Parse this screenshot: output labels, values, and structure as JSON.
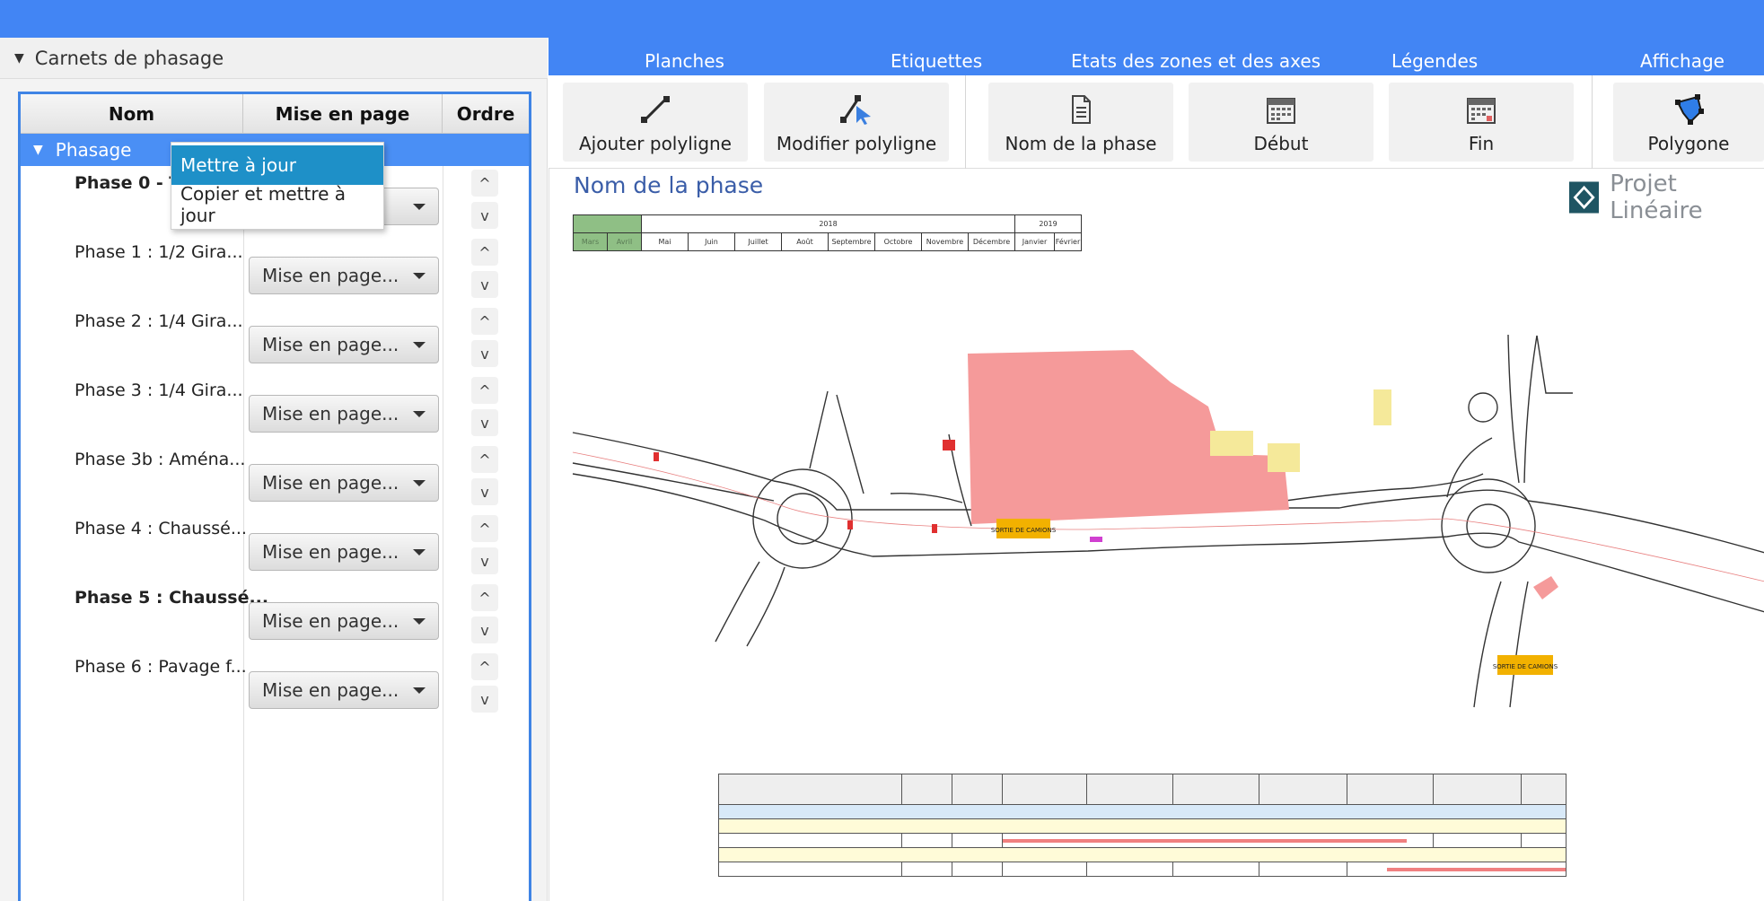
{
  "panel": {
    "title": "Carnets de phasage"
  },
  "table": {
    "headers": {
      "nom": "Nom",
      "mise_en_page": "Mise en page",
      "ordre": "Ordre"
    },
    "group": "Phasage",
    "rows": [
      {
        "name": "Phase 0 - Tr",
        "layout": "",
        "bold": true
      },
      {
        "name": "Phase 1 : 1/2 Gira...",
        "layout": "Mise en page..."
      },
      {
        "name": "Phase 2 : 1/4 Gira...",
        "layout": "Mise en page..."
      },
      {
        "name": "Phase 3 : 1/4 Gira...",
        "layout": "Mise en page..."
      },
      {
        "name": "Phase 3b : Aména...",
        "layout": "Mise en page..."
      },
      {
        "name": "Phase 4 : Chaussé...",
        "layout": "Mise en page..."
      },
      {
        "name": "Phase 5 : Chaussé...",
        "layout": "Mise en page...",
        "bold": true
      },
      {
        "name": "Phase 6 : Pavage f...",
        "layout": "Mise en page..."
      }
    ],
    "order_up": "^",
    "order_down": "v"
  },
  "context_menu": {
    "items": [
      "Mettre à jour",
      "Copier et mettre à jour"
    ]
  },
  "ribbon": {
    "tabs": [
      "Planches",
      "Etiquettes",
      "Etats des zones et des axes",
      "Légendes",
      "Affichage"
    ],
    "tools": [
      "Ajouter polyligne",
      "Modifier polyligne",
      "Nom de la phase",
      "Début",
      "Fin",
      "Polygone"
    ]
  },
  "canvas": {
    "phase_title": "Nom de la phase",
    "logo_text": "Projet Linéaire",
    "timeline": {
      "years": [
        "2018",
        "2019"
      ],
      "months": [
        "Mars",
        "Avril",
        "Mai",
        "Juin",
        "Juillet",
        "Août",
        "Septembre",
        "Octobre",
        "Novembre",
        "Décembre",
        "Janvier",
        "Février"
      ]
    },
    "signs": [
      "SORTIE DE CAMIONS",
      "SORTIE DE CAMIONS"
    ]
  },
  "colors": {
    "accent": "#4285f4",
    "zone_fill": "#f59a9a",
    "timeline_highlight": "#8fbf85"
  }
}
